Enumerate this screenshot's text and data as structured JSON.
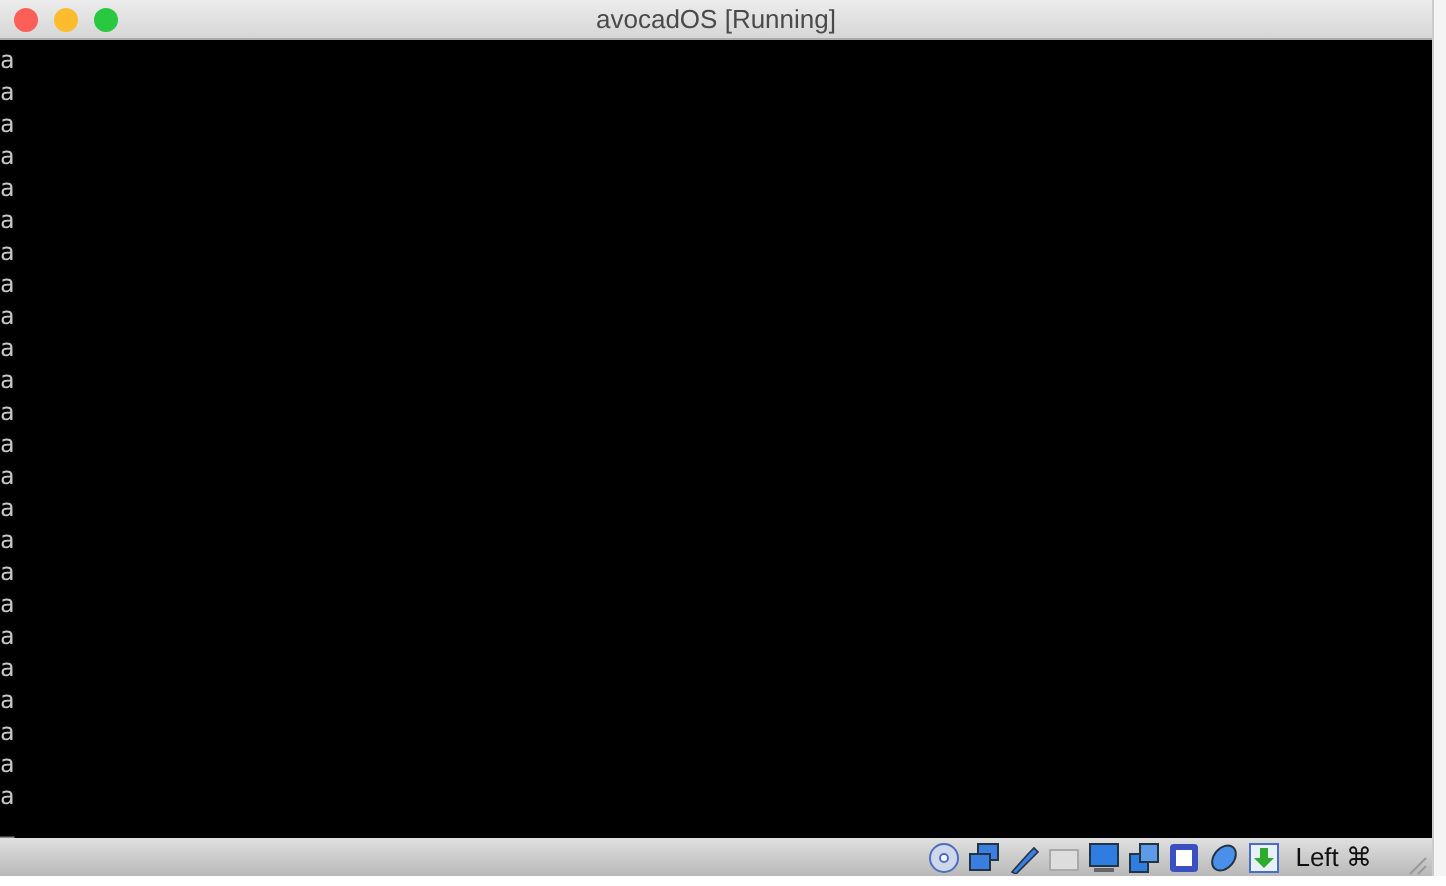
{
  "window": {
    "title": "avocadOS [Running]"
  },
  "console": {
    "lines": [
      "a",
      "a",
      "a",
      "a",
      "a",
      "a",
      "a",
      "a",
      "a",
      "a",
      "a",
      "a",
      "a",
      "a",
      "a",
      "a",
      "a",
      "a",
      "a",
      "a",
      "a",
      "a",
      "a",
      "a"
    ],
    "cursor": "_"
  },
  "status_bar": {
    "host_key": "Left ⌘"
  }
}
